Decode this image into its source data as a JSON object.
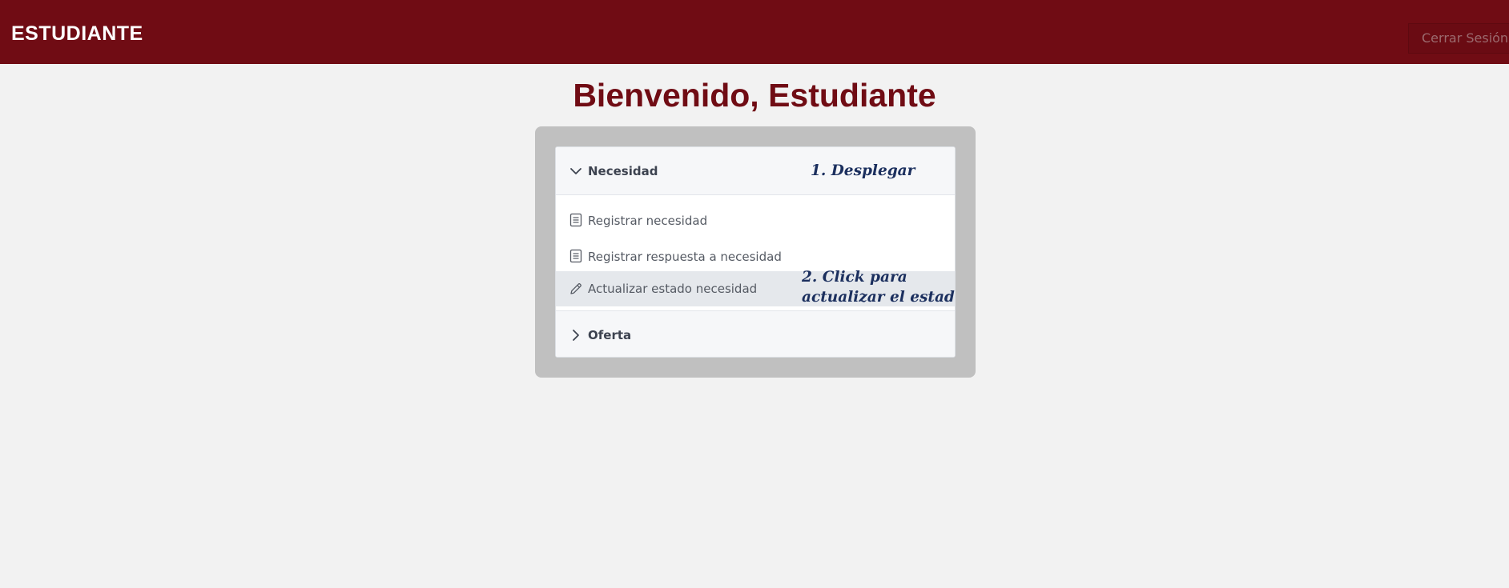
{
  "header": {
    "brand": "ESTUDIANTE",
    "logout_label": "Cerrar Sesión"
  },
  "main": {
    "welcome": "Bienvenido, Estudiante"
  },
  "menu": {
    "sections": [
      {
        "label": "Necesidad",
        "expanded": true,
        "items": [
          {
            "label": "Registrar necesidad",
            "icon": "document-list-icon"
          },
          {
            "label": "Registrar respuesta a necesidad",
            "icon": "document-list-icon"
          },
          {
            "label": "Actualizar estado necesidad",
            "icon": "pencil-icon",
            "highlighted": true
          }
        ]
      },
      {
        "label": "Oferta",
        "expanded": false,
        "items": []
      }
    ]
  },
  "annotations": {
    "step1": "1. Desplegar",
    "step2_line1": "2. Click para",
    "step2_line2": "actualizar el estado"
  },
  "colors": {
    "brand": "#700c14",
    "background": "#f2f2f2",
    "card": "#c0c0c0",
    "highlight": "#e5e8ec",
    "annotation": "#1b2f5e"
  }
}
